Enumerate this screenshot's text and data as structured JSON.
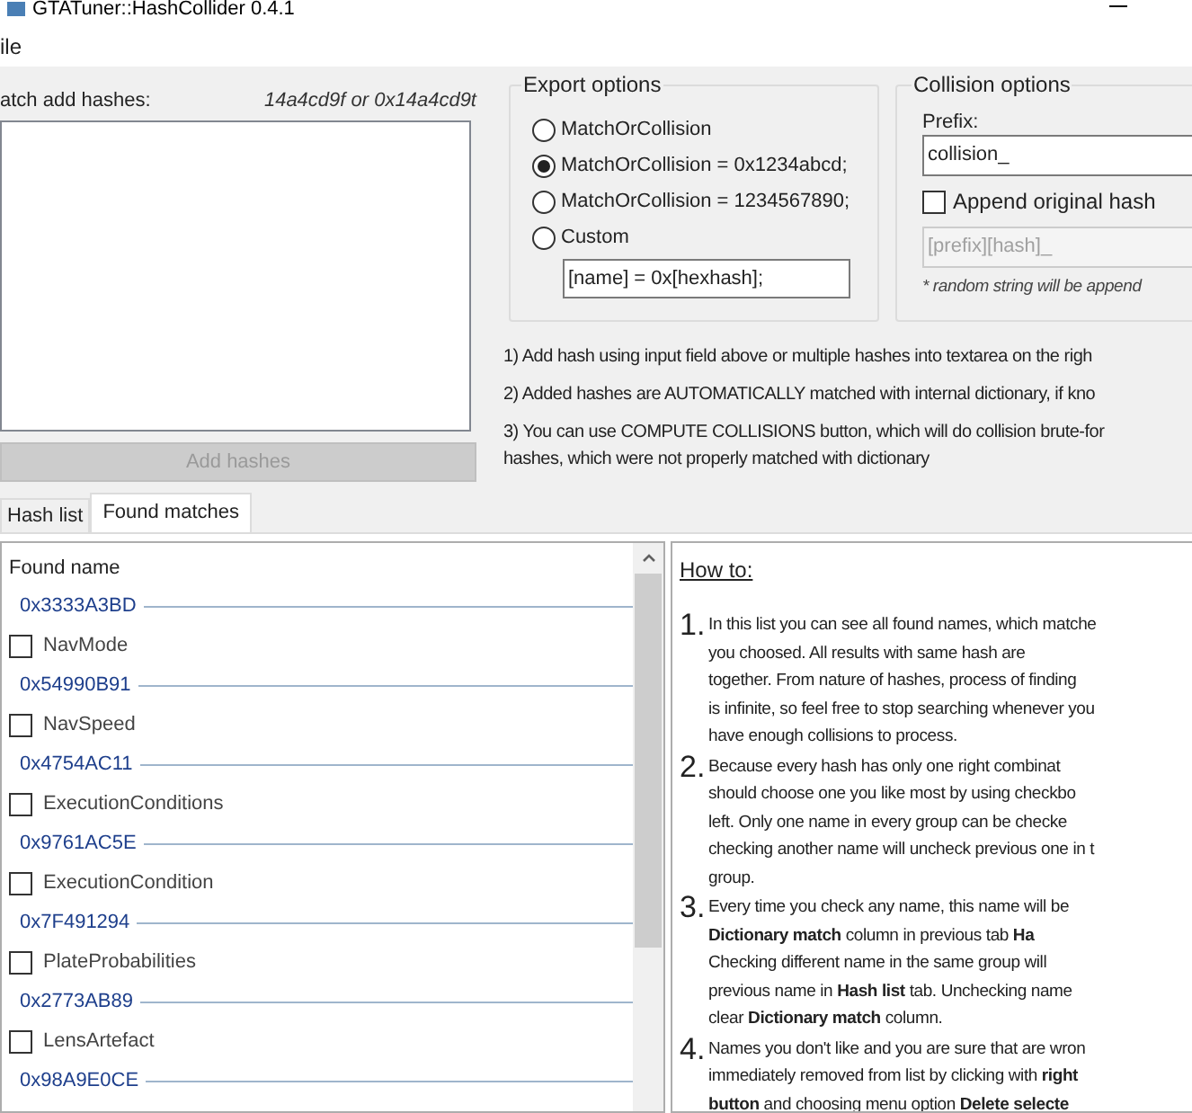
{
  "window": {
    "title": "GTATuner::HashCollider 0.4.1"
  },
  "menu": [
    {
      "label": "ile"
    }
  ],
  "batch": {
    "label": "atch add hashes:",
    "hint": "14a4cd9f or 0x14a4cd9t",
    "button": {
      "label": "Add hashes",
      "disabled": true
    }
  },
  "export_options": {
    "title": "Export options",
    "options": [
      {
        "label": "MatchOrCollision",
        "selected": false
      },
      {
        "label": "MatchOrCollision = 0x1234abcd;",
        "selected": true
      },
      {
        "label": "MatchOrCollision = 1234567890;",
        "selected": false
      },
      {
        "label": "Custom",
        "selected": false
      }
    ],
    "custom_format": "[name] = 0x[hexhash];"
  },
  "collision_options": {
    "title": "Collision options",
    "prefix_label": "Prefix:",
    "prefix_value": "collision_",
    "append_original_hash": {
      "label": "Append original hash",
      "checked": false
    },
    "pattern_value": "[prefix][hash]_",
    "note": "* random string will be append"
  },
  "instructions": [
    {
      "lines": [
        "1) Add hash using input field above or multiple hashes into textarea on the righ"
      ]
    },
    {
      "lines": [
        "2) Added hashes are AUTOMATICALLY matched with internal dictionary, if kno"
      ]
    },
    {
      "lines": [
        "3) You can use COMPUTE COLLISIONS button, which will do collision brute-for",
        "hashes, which were not properly matched with dictionary"
      ]
    }
  ],
  "tabs": [
    {
      "label": "Hash list",
      "selected": false
    },
    {
      "label": "Found matches",
      "selected": true
    }
  ],
  "found_list": {
    "column": "Found name",
    "groups": [
      {
        "hash": "0x3333A3BD",
        "names": [
          {
            "name": "NavMode",
            "checked": false
          }
        ]
      },
      {
        "hash": "0x54990B91",
        "names": [
          {
            "name": "NavSpeed",
            "checked": false
          }
        ]
      },
      {
        "hash": "0x4754AC11",
        "names": [
          {
            "name": "ExecutionConditions",
            "checked": false
          }
        ]
      },
      {
        "hash": "0x9761AC5E",
        "names": [
          {
            "name": "ExecutionCondition",
            "checked": false
          }
        ]
      },
      {
        "hash": "0x7F491294",
        "names": [
          {
            "name": "PlateProbabilities",
            "checked": false
          }
        ]
      },
      {
        "hash": "0x2773AB89",
        "names": [
          {
            "name": "LensArtefact",
            "checked": false
          }
        ]
      },
      {
        "hash": "0x98A9E0CE"
      }
    ]
  },
  "how_to": {
    "title": "How to:",
    "steps": [
      {
        "number": "1.",
        "lines": [
          "In this list you can see all found names, which matche",
          "you choosed. All results with same hash are",
          "together. From nature of hashes, process of finding",
          "is infinite, so feel free to stop searching whenever you",
          "have enough collisions to process."
        ]
      },
      {
        "number": "2.",
        "lines": [
          "Because every hash has only one right combinat",
          "should choose one you like most by using checkbo",
          "left. Only one name in every group can be checke",
          "checking another name will uncheck previous one in t",
          "group."
        ]
      },
      {
        "number": "3.",
        "lines": [
          "Every time you check any name, this name will be",
          "**Dictionary match** column in previous tab **Ha**",
          "Checking different name in the same group will",
          "previous name in **Hash list** tab. Unchecking name",
          "clear **Dictionary match** column."
        ]
      },
      {
        "number": "4.",
        "lines": [
          "Names you don't like and you are sure that are wron",
          "immediately removed from list by clicking with **right**",
          "**button** and choosing menu option **Delete selecte**"
        ]
      }
    ]
  }
}
